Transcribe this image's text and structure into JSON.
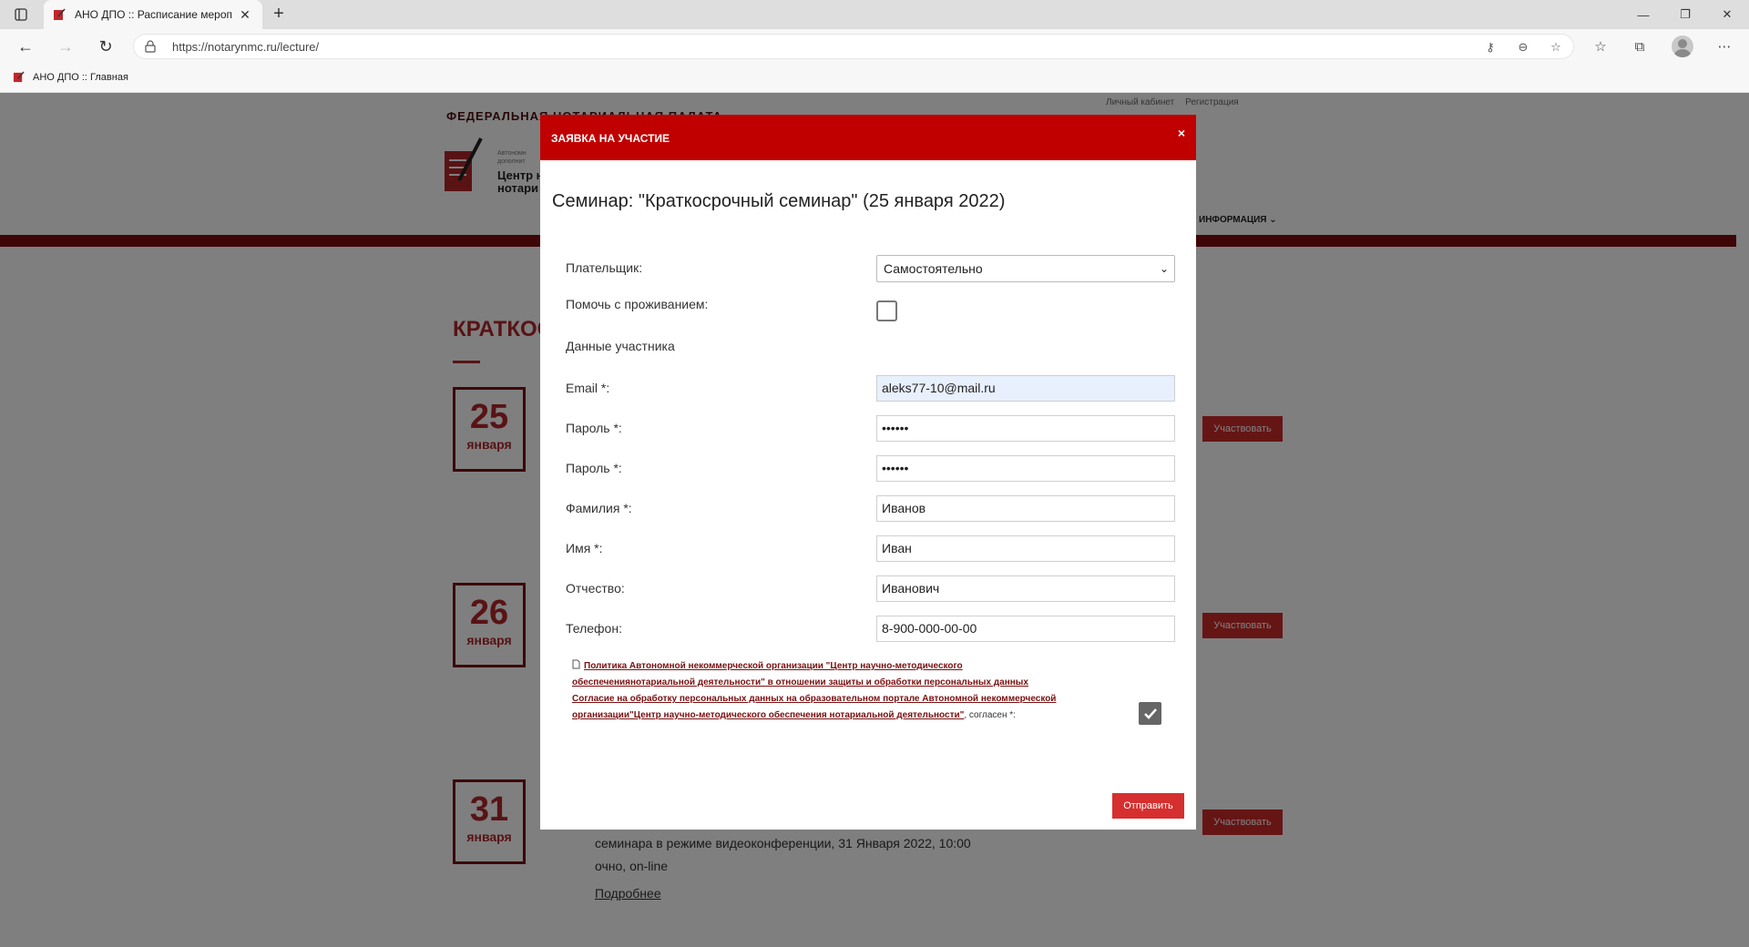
{
  "browser": {
    "tab_title": "АНО ДПО :: Расписание мероп",
    "url": "https://notarynmc.ru/lecture/",
    "bookmark_label": "АНО ДПО :: Главная"
  },
  "site": {
    "top_links": [
      "Личный кабинет",
      "Регистрация"
    ],
    "fed_title": "ФЕДЕРАЛЬНАЯ НОТАРИАЛЬНАЯ ПАЛАТА",
    "logo_small_lines": [
      "Автономн",
      "дополнит"
    ],
    "logo_big_lines": [
      "Центр н",
      "нотари"
    ],
    "menu_item": "ИНФОРМАЦИЯ",
    "section_heading": "КРАТКОС",
    "events": [
      {
        "day": "25",
        "month": "января",
        "join_label": "Участвовать"
      },
      {
        "day": "26",
        "month": "января",
        "join_label": "Участвовать"
      },
      {
        "day": "31",
        "month": "января",
        "join_label": "Участвовать"
      }
    ],
    "event_text_line1": "семинара в режиме видеоконференции, 31 Января 2022, 10:00",
    "event_text_line2": "очно, on-line",
    "event_more": "Подробнее"
  },
  "modal": {
    "title": "ЗАЯВКА НА УЧАСТИЕ",
    "close": "×",
    "heading": "Семинар: \"Краткосрочный семинар\" (25 января 2022)",
    "payer_label": "Плательщик:",
    "payer_value": "Самостоятельно",
    "housing_label": "Помочь с проживанием:",
    "participant_section": "Данные участника",
    "email_label": "Email *:",
    "email_value": "aleks77-10@mail.ru",
    "password_label": "Пароль *:",
    "password_value": "••••••",
    "password2_label": "Пароль *:",
    "password2_value": "••••••",
    "surname_label": "Фамилия *:",
    "surname_value": "Иванов",
    "name_label": "Имя *:",
    "name_value": "Иван",
    "patronymic_label": "Отчество:",
    "patronymic_value": "Иванович",
    "phone_label": "Телефон:",
    "phone_value": "8-900-000-00-00",
    "policy_link": "Политика Автономной некоммерческой организации \"Центр научно-методического обеспечениянотариальной деятельности\" в отношении защиты и обработки персональных данных",
    "consent_link": "Согласие на обработку персональных данных на образовательном портале Автономной некоммерческой организации\"Центр научно-методического обеспечения нотариальной деятельности\"",
    "consent_suffix": ", согласен *:",
    "submit": "Отправить"
  },
  "colors": {
    "brand_red": "#c00000",
    "dark_red": "#7a1010"
  }
}
